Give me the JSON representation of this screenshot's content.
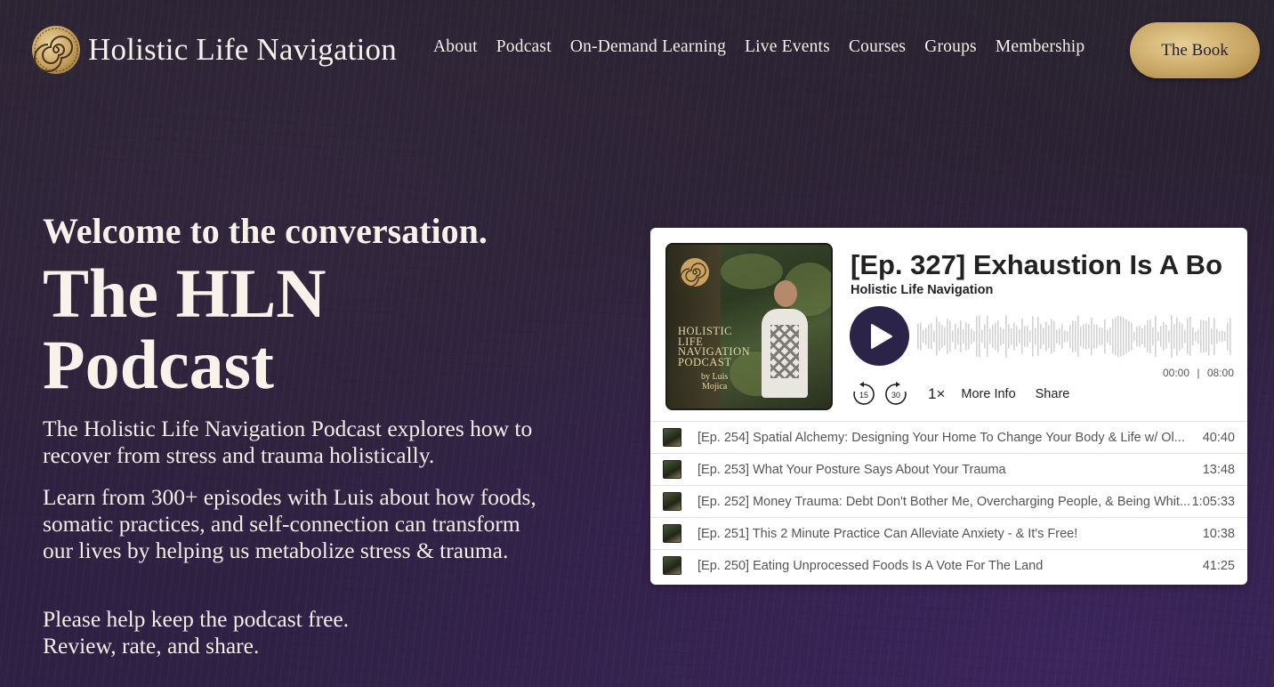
{
  "header": {
    "brand_name": "Holistic Life Navigation",
    "nav": [
      "About",
      "Podcast",
      "On-Demand Learning",
      "Live Events",
      "Courses",
      "Groups",
      "Membership"
    ],
    "cta_label": "The Book"
  },
  "hero": {
    "welcome": "Welcome to the conversation.",
    "title_line1": "The HLN",
    "title_line2": "Podcast",
    "p1": "The Holistic Life Navigation Podcast explores how to recover from stress and trauma holistically.",
    "p2": "Learn from 300+ episodes with Luis about how foods, somatic practices, and self-connection can transform our lives by helping us metabolize stress & trauma.",
    "p3_line1": "Please help keep the podcast free.",
    "p3_line2": "Review, rate, and share."
  },
  "player": {
    "cover_text": [
      "Holistic",
      "Life",
      "Navigation",
      "Podcast"
    ],
    "cover_author_by": "by Luis",
    "cover_author_last": "Mojica",
    "episode_title": "[Ep. 327] Exhaustion Is A Bo",
    "show_name": "Holistic Life Navigation",
    "time_current": "00:00",
    "time_separator": "|",
    "time_total": "08:00",
    "skip_back": "15",
    "skip_forward": "30",
    "speed": "1×",
    "more_info": "More Info",
    "share": "Share",
    "colors": {
      "play_button": "#2c2448",
      "gold": "#caa866"
    },
    "episodes": [
      {
        "title": "[Ep. 254] Spatial Alchemy: Designing Your Home To Change Your Body & Life w/ Ol...",
        "duration": "40:40"
      },
      {
        "title": "[Ep. 253] What Your Posture Says About Your Trauma",
        "duration": "13:48"
      },
      {
        "title": "[Ep. 252] Money Trauma: Debt Don't Bother Me, Overcharging People, & Being Whit...",
        "duration": "1:05:33"
      },
      {
        "title": "[Ep. 251] This 2 Minute Practice Can Alleviate Anxiety - & It's Free!",
        "duration": "10:38"
      },
      {
        "title": "[Ep. 250] Eating Unprocessed Foods Is A Vote For The Land",
        "duration": "41:25"
      }
    ]
  }
}
